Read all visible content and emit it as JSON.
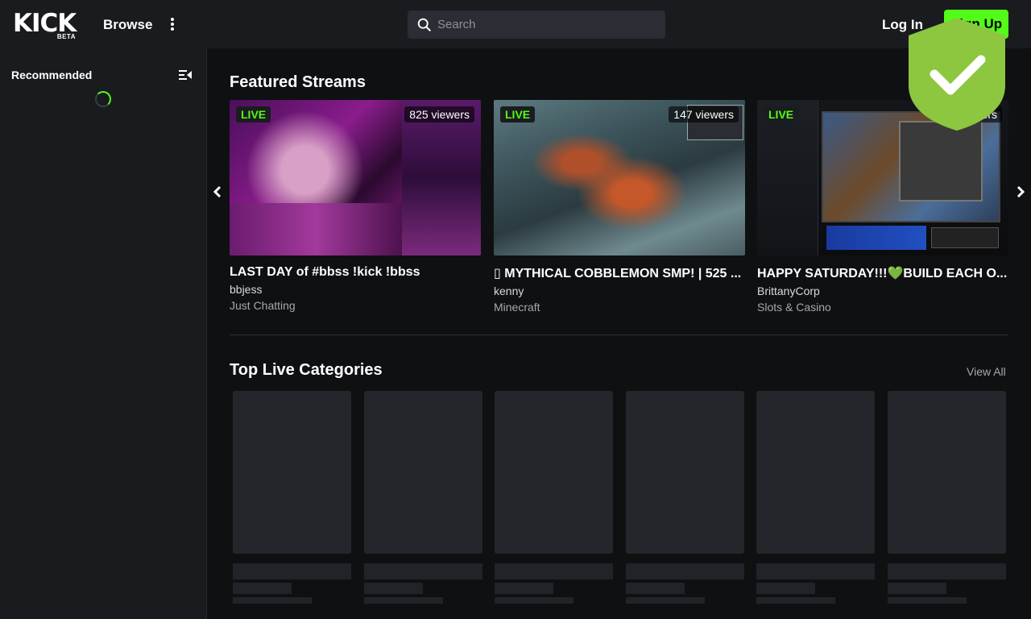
{
  "header": {
    "logo_text": "KICK",
    "logo_badge": "BETA",
    "browse_label": "Browse",
    "search_placeholder": "Search",
    "login_label": "Log In",
    "signup_label": "Sign Up",
    "accent_color": "#53fc18"
  },
  "sidebar": {
    "recommended_title": "Recommended"
  },
  "main": {
    "featured_title": "Featured Streams",
    "featured": [
      {
        "live_label": "LIVE",
        "viewers": "825 viewers",
        "title": "LAST DAY of #bbss !kick !bbss",
        "user": "bbjess",
        "category": "Just Chatting"
      },
      {
        "live_label": "LIVE",
        "viewers": "147 viewers",
        "title": "▯ MYTHICAL COBBLEMON SMP! | 525 ...",
        "user": "kenny",
        "category": "Minecraft"
      },
      {
        "live_label": "LIVE",
        "viewers": "viewers",
        "title": "HAPPY SATURDAY!!!💚BUILD EACH O...",
        "user": "BrittanyCorp",
        "category": "Slots & Casino"
      }
    ],
    "categories_title": "Top Live Categories",
    "view_all_label": "View All"
  },
  "icons": {
    "search": "search-icon",
    "more": "kebab-menu-icon",
    "collapse": "sidebar-collapse-icon",
    "prev": "chevron-left-icon",
    "next": "chevron-right-icon",
    "shield": "shield-check-icon"
  }
}
